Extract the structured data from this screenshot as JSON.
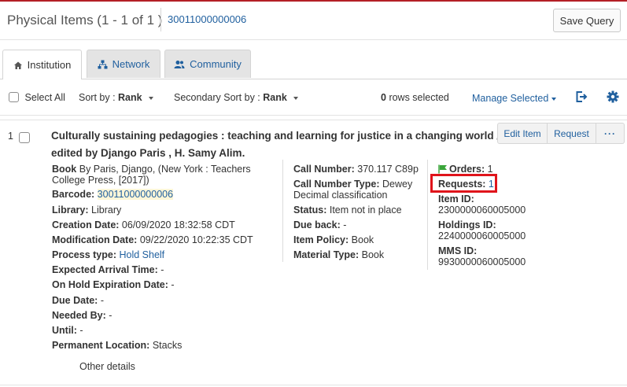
{
  "header": {
    "title": "Physical Items (1 - 1 of 1 )",
    "barcode_link": "30011000000006",
    "save_query": "Save Query"
  },
  "tabs": [
    {
      "label": "Institution",
      "icon": "institution-icon",
      "active": true
    },
    {
      "label": "Network",
      "icon": "network-icon",
      "active": false
    },
    {
      "label": "Community",
      "icon": "community-icon",
      "active": false
    }
  ],
  "toolbar": {
    "select_all": "Select All",
    "sort_by_label": "Sort by :",
    "sort_by_value": "Rank",
    "secondary_sort_label": "Secondary Sort by :",
    "secondary_sort_value": "Rank",
    "rows_selected_count": "0",
    "rows_selected_text": "rows selected",
    "manage_selected": "Manage Selected"
  },
  "result": {
    "index": "1",
    "title_line1": "Culturally sustaining pedagogies : teaching and learning for justice in a changing world /",
    "title_line2": "edited by Django Paris , H. Samy Alim.",
    "actions": {
      "edit": "Edit Item",
      "request": "Request",
      "more": "···"
    },
    "col1": {
      "book_label": "Book",
      "book_line1": "By Paris, Django, (New York : Teachers",
      "book_line2": "College Press, [2017])",
      "barcode_label": "Barcode:",
      "barcode_value": "30011000000006",
      "library_label": "Library:",
      "library_value": "Library",
      "creation_label": "Creation Date:",
      "creation_value": "06/09/2020 18:32:58 CDT",
      "modification_label": "Modification Date:",
      "modification_value": "09/22/2020 10:22:35 CDT",
      "process_label": "Process type:",
      "process_value": "Hold Shelf",
      "arrival_label": "Expected Arrival Time:",
      "arrival_value": "-",
      "onhold_label": "On Hold Expiration Date:",
      "onhold_value": "-",
      "due_label": "Due Date:",
      "due_value": "-",
      "needed_label": "Needed By:",
      "needed_value": "-",
      "until_label": "Until:",
      "until_value": "-",
      "permloc_label": "Permanent Location:",
      "permloc_value": "Stacks",
      "other_details": "Other details"
    },
    "col2": {
      "callnum_label": "Call Number:",
      "callnum_value": "370.117 C89p",
      "calltype_label": "Call Number Type:",
      "calltype_line1": "Dewey",
      "calltype_line2": "Decimal classification",
      "status_label": "Status:",
      "status_value": "Item not in place",
      "dueback_label": "Due back:",
      "dueback_value": "-",
      "policy_label": "Item Policy:",
      "policy_value": "Book",
      "material_label": "Material Type:",
      "material_value": "Book"
    },
    "col3": {
      "orders_label": "Orders:",
      "orders_value": "1",
      "requests_label": "Requests:",
      "requests_value": "1",
      "itemid_label": "Item ID:",
      "itemid_value": "2300000060005000",
      "holdings_label": "Holdings ID:",
      "holdings_value": "2240000060005000",
      "mms_label": "MMS ID:",
      "mms_value": "9930000060005000"
    }
  },
  "colors": {
    "link": "#1f5f9e",
    "highlight": "#e0141b",
    "flag": "#3aa53a",
    "top_line": "#b41f26"
  }
}
